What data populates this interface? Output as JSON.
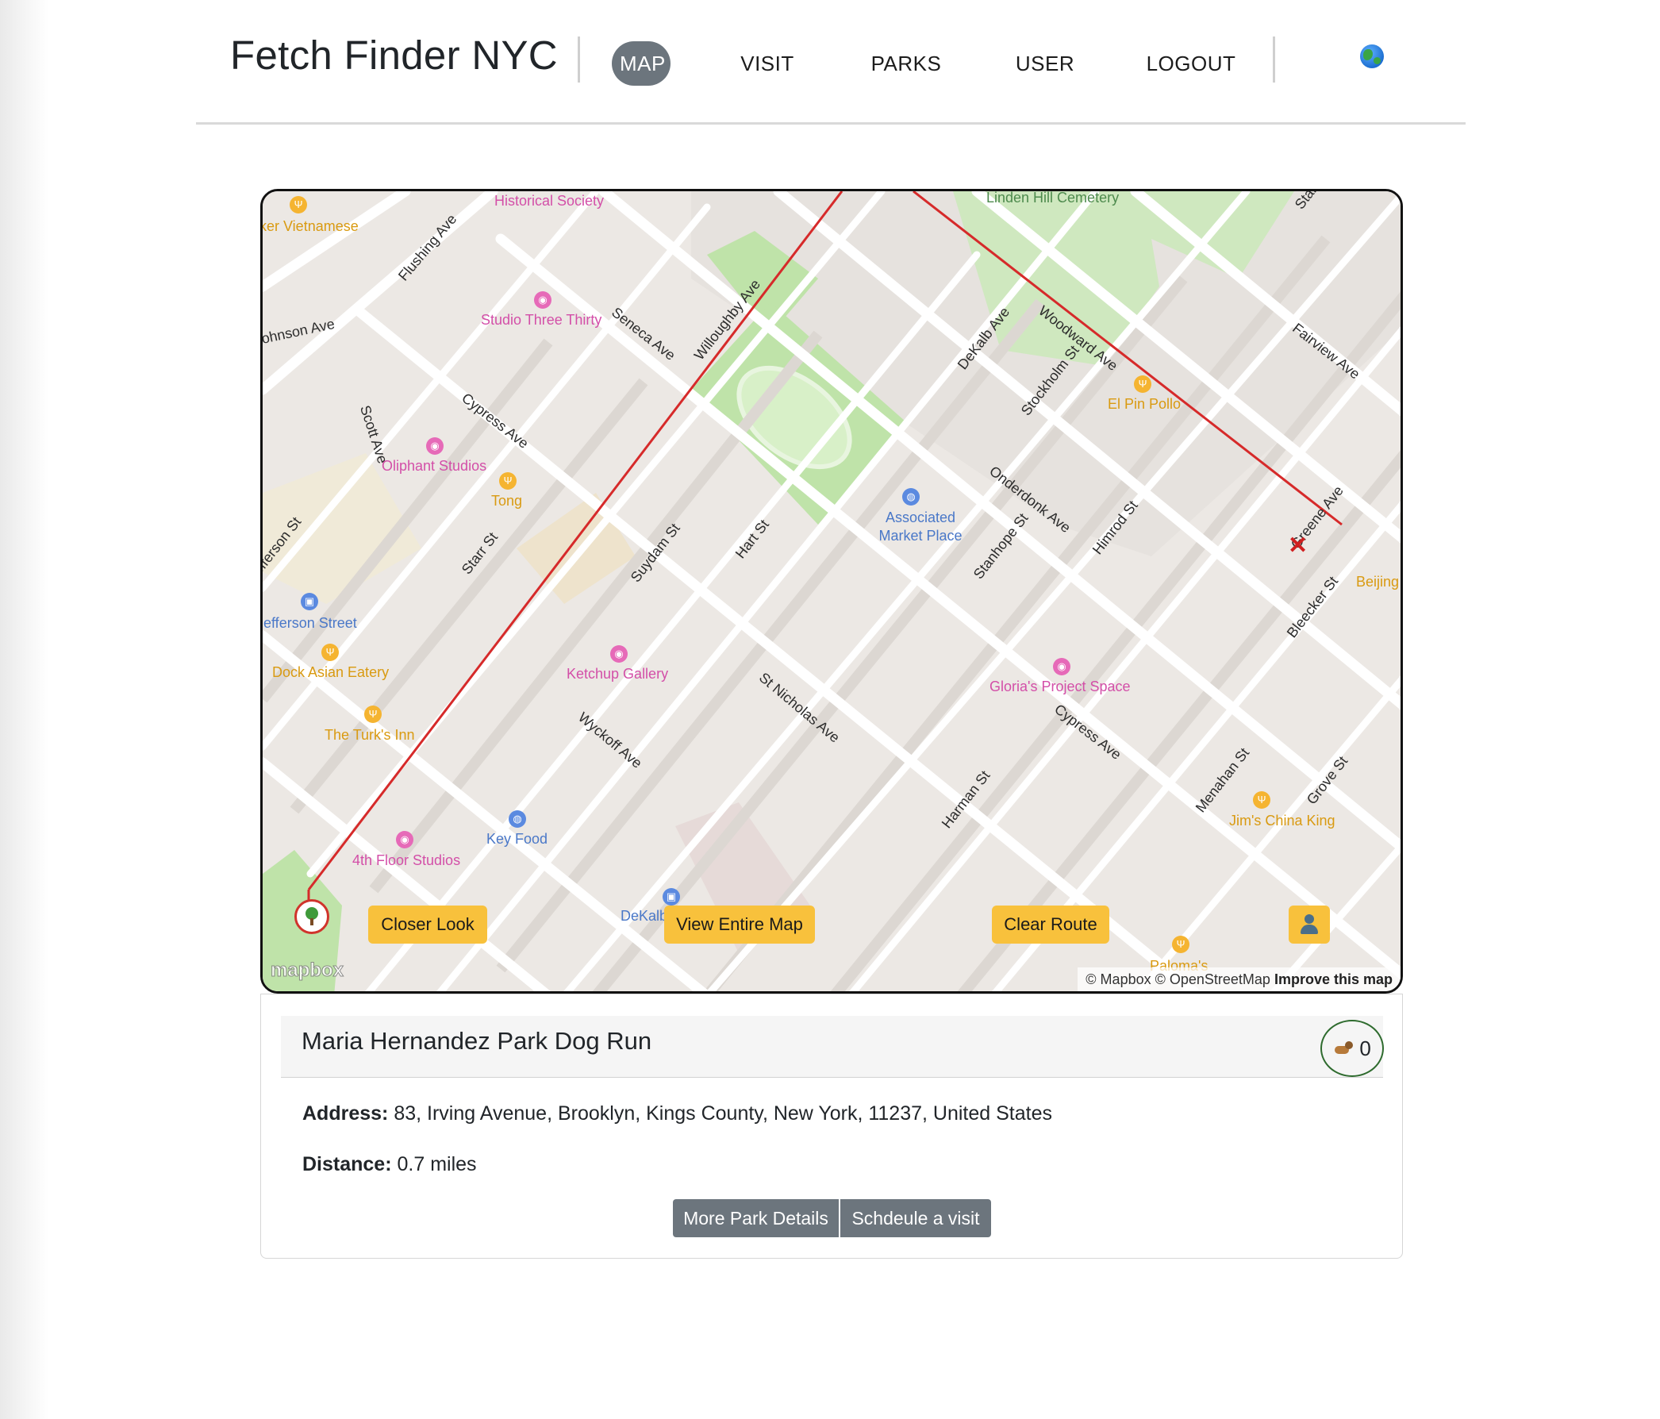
{
  "navbar": {
    "brand": "Fetch Finder NYC",
    "items": [
      {
        "label": "MAP",
        "active": true
      },
      {
        "label": "VISIT",
        "active": false
      },
      {
        "label": "PARKS",
        "active": false
      },
      {
        "label": "USER",
        "active": false
      },
      {
        "label": "LOGOUT",
        "active": false
      }
    ],
    "language_icon": "globe-icon"
  },
  "map": {
    "streets": [
      "Flushing Ave",
      "Johnson Ave",
      "Scott Ave",
      "Cypress Ave",
      "Seneca Ave",
      "Willoughby Ave",
      "Starr St",
      "Jefferson St",
      "Suydam St",
      "Hart St",
      "DeKalb Ave",
      "Woodward Ave",
      "Stockholm St",
      "Onderdonk Ave",
      "Stanhope St",
      "Himrod St",
      "Greene Ave",
      "Fairview Ave",
      "Bleecker St",
      "St Nicholas Ave",
      "Wyckoff Ave",
      "Harman St",
      "Menahan St",
      "Grove St",
      "Starr St",
      "Cypress Ave"
    ],
    "pois": [
      {
        "name": "Historical Society",
        "category": "pink"
      },
      {
        "name": "Studio Three Thirty",
        "category": "pink"
      },
      {
        "name": "Oliphant Studios",
        "category": "pink"
      },
      {
        "name": "Tong",
        "category": "orange"
      },
      {
        "name": "Jefferson Street",
        "category": "blue"
      },
      {
        "name": "Dock Asian Eatery",
        "category": "orange"
      },
      {
        "name": "The Turk's Inn",
        "category": "orange"
      },
      {
        "name": "Ketchup Gallery",
        "category": "pink"
      },
      {
        "name": "Key Food",
        "category": "blue"
      },
      {
        "name": "4th Floor Studios",
        "category": "pink"
      },
      {
        "name": "Associated Market Place",
        "category": "blue"
      },
      {
        "name": "El Pin Pollo",
        "category": "orange"
      },
      {
        "name": "Linden Hill Cemetery",
        "category": "green"
      },
      {
        "name": "Gloria's Project Space",
        "category": "pink"
      },
      {
        "name": "Beijing",
        "category": "orange"
      },
      {
        "name": "Jim's China King",
        "category": "orange"
      },
      {
        "name": "Paloma's",
        "category": "orange"
      },
      {
        "name": "ker Vietnamese",
        "category": "orange"
      },
      {
        "name": "DeKalb",
        "category": "blue"
      }
    ],
    "buttons": {
      "closer_look": "Closer Look",
      "view_entire_map": "View Entire Map",
      "clear_route": "Clear Route",
      "user_location_icon": "user-icon"
    },
    "mapbox_logo": "mapbox",
    "attribution": "© Mapbox © OpenStreetMap",
    "improve_link": "Improve this map",
    "route_color": "#d62a2a"
  },
  "park": {
    "name": "Maria Hernandez Park Dog Run",
    "dog_count": "0",
    "address_label": "Address:",
    "address": "83, Irving Avenue, Brooklyn, Kings County, New York, 11237, United States",
    "distance_label": "Distance:",
    "distance": "0.7 miles",
    "more_details_button": "More Park Details",
    "schedule_button": "Schdeule a visit"
  },
  "colors": {
    "accent_yellow": "#f8c13c",
    "nav_active": "#6c757d",
    "badge_border": "#2e6b2e"
  }
}
